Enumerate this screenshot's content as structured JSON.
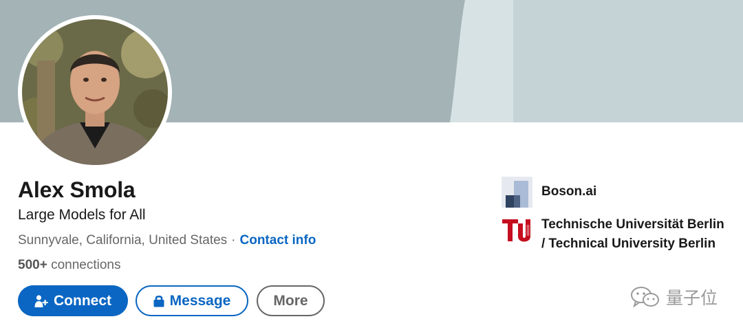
{
  "profile": {
    "name": "Alex Smola",
    "headline": "Large Models for All",
    "location": "Sunnyvale, California, United States",
    "separator": "·",
    "contact_info_label": "Contact info",
    "connections_count": "500+",
    "connections_label": "connections"
  },
  "actions": {
    "connect_label": "Connect",
    "message_label": "Message",
    "more_label": "More"
  },
  "organizations": [
    {
      "name": "Boson.ai",
      "logo": "boson-logo"
    },
    {
      "name": "Technische Universität Berlin / Technical University Berlin",
      "logo": "tu-berlin-logo"
    }
  ],
  "watermark": {
    "text": "量子位",
    "icon": "wechat-icon"
  },
  "colors": {
    "brand_blue": "#0a66c2",
    "cover_left": "#a3b3b6",
    "cover_right": "#c5d3d7",
    "tu_red": "#c50e1f"
  }
}
